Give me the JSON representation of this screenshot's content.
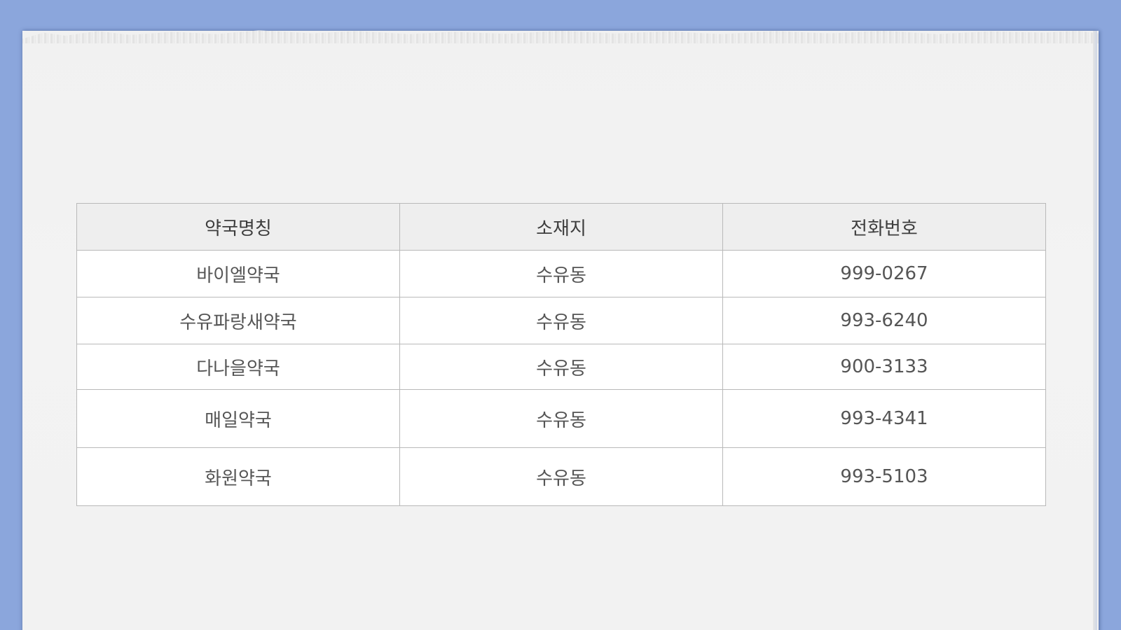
{
  "table": {
    "headers": [
      "약국명칭",
      "소재지",
      "전화번호"
    ],
    "rows": [
      {
        "name": "바이엘약국",
        "location": "수유동",
        "phone": "999-0267"
      },
      {
        "name": "수유파랑새약국",
        "location": "수유동",
        "phone": "993-6240"
      },
      {
        "name": "다나을약국",
        "location": "수유동",
        "phone": "900-3133"
      },
      {
        "name": "매일약국",
        "location": "수유동",
        "phone": "993-4341"
      },
      {
        "name": "화원약국",
        "location": "수유동",
        "phone": "993-5103"
      }
    ]
  },
  "colors": {
    "background": "#8ba6dc",
    "paper": "#f2f2f2",
    "header_fill": "#eeeeee",
    "border": "#b9b9b9",
    "text": "#555555"
  }
}
